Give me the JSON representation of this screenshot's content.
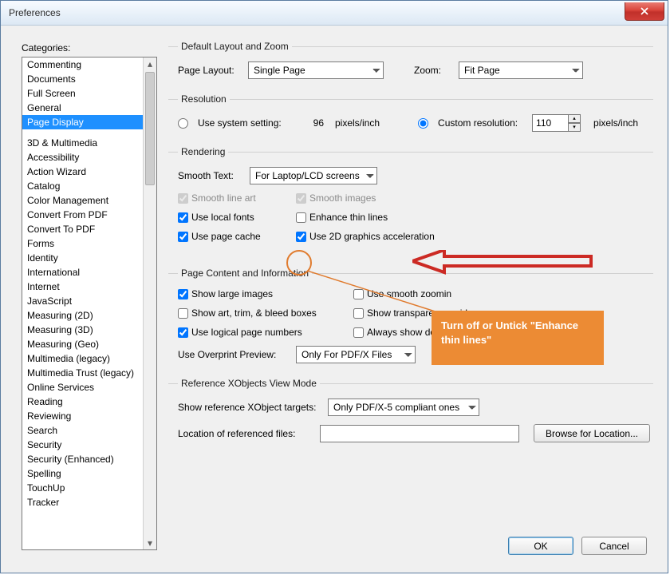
{
  "window": {
    "title": "Preferences"
  },
  "sidebar": {
    "label": "Categories:",
    "items_above": [
      "Commenting",
      "Documents",
      "Full Screen",
      "General",
      "Page Display"
    ],
    "items_below": [
      "3D & Multimedia",
      "Accessibility",
      "Action Wizard",
      "Catalog",
      "Color Management",
      "Convert From PDF",
      "Convert To PDF",
      "Forms",
      "Identity",
      "International",
      "Internet",
      "JavaScript",
      "Measuring (2D)",
      "Measuring (3D)",
      "Measuring (Geo)",
      "Multimedia (legacy)",
      "Multimedia Trust (legacy)",
      "Online Services",
      "Reading",
      "Reviewing",
      "Search",
      "Security",
      "Security (Enhanced)",
      "Spelling",
      "TouchUp",
      "Tracker"
    ],
    "selected": "Page Display"
  },
  "layout": {
    "legend": "Default Layout and Zoom",
    "page_layout_label": "Page Layout:",
    "page_layout_value": "Single Page",
    "zoom_label": "Zoom:",
    "zoom_value": "Fit Page"
  },
  "resolution": {
    "legend": "Resolution",
    "system_label": "Use system setting:",
    "system_value": "96",
    "system_unit": "pixels/inch",
    "custom_label": "Custom resolution:",
    "custom_value": "110",
    "custom_unit": "pixels/inch",
    "selected": "custom"
  },
  "rendering": {
    "legend": "Rendering",
    "smooth_text_label": "Smooth Text:",
    "smooth_text_value": "For Laptop/LCD screens",
    "checks": {
      "smooth_line_art": {
        "label": "Smooth line art",
        "checked": true,
        "disabled": true
      },
      "smooth_images": {
        "label": "Smooth images",
        "checked": true,
        "disabled": true
      },
      "use_local_fonts": {
        "label": "Use local fonts",
        "checked": true
      },
      "enhance_thin_lines": {
        "label": "Enhance thin lines",
        "checked": false
      },
      "use_page_cache": {
        "label": "Use page cache",
        "checked": true
      },
      "use_2d_accel": {
        "label": "Use 2D graphics acceleration",
        "checked": true
      }
    }
  },
  "pagecontent": {
    "legend": "Page Content and Information",
    "checks": {
      "show_large_images": {
        "label": "Show large images",
        "checked": true
      },
      "use_smooth_zooming": {
        "label": "Use smooth zoomin",
        "checked": false
      },
      "show_art_trim_bleed": {
        "label": "Show art, trim, & bleed boxes",
        "checked": false
      },
      "show_transparency_grid": {
        "label": "Show transparency grid",
        "checked": false
      },
      "use_logical_page_numbers": {
        "label": "Use logical page numbers",
        "checked": true
      },
      "always_show_doc_size": {
        "label": "Always show document page size",
        "checked": false
      }
    },
    "overprint_label": "Use Overprint Preview:",
    "overprint_value": "Only For PDF/X Files"
  },
  "refxobj": {
    "legend": "Reference XObjects View Mode",
    "targets_label": "Show reference XObject targets:",
    "targets_value": "Only PDF/X-5 compliant ones",
    "location_label": "Location of referenced files:",
    "location_value": "",
    "browse_label": "Browse for Location..."
  },
  "footer": {
    "ok": "OK",
    "cancel": "Cancel"
  },
  "annotation": {
    "callout_text": "Turn off or Untick \"Enhance thin lines\""
  }
}
